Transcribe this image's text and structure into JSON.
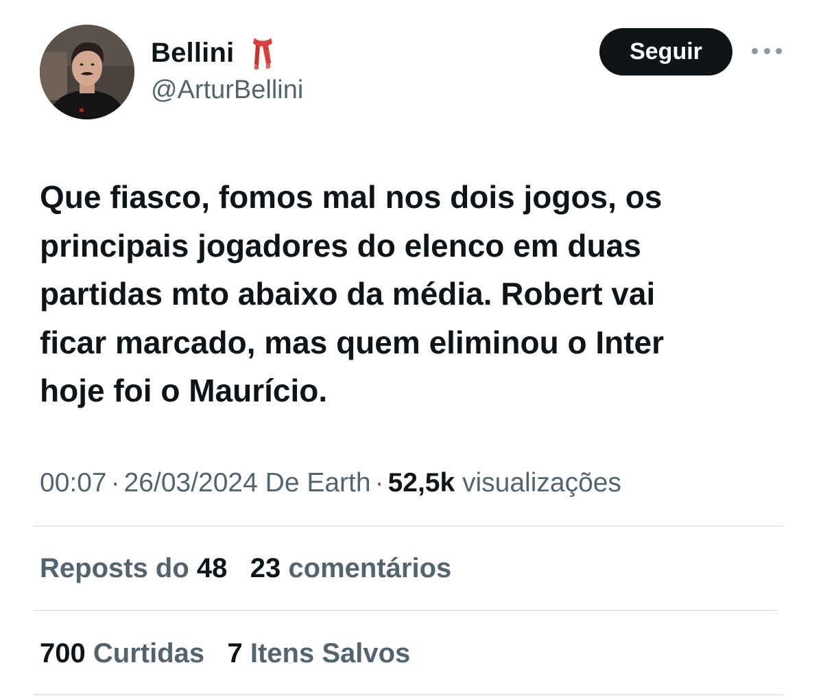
{
  "author": {
    "display_name": "Bellini",
    "handle": "@ArturBellini",
    "avatar_icon": "profile-photo",
    "badge_icon": "scarf-icon"
  },
  "follow_button": {
    "label": "Seguir"
  },
  "more_icon": "more-horizontal-icon",
  "tweet": {
    "lines": [
      "Que fiasco, fomos mal nos dois jogos, os",
      "principais jogadores do elenco em duas",
      "partidas mto abaixo da média. Robert vai",
      "ficar marcado, mas quem eliminou o Inter",
      "hoje foi o Maurício."
    ]
  },
  "meta": {
    "time": "00:07",
    "separator": "·",
    "date": "26/03/2024",
    "source": "De Earth",
    "views_count": "52,5k",
    "views_label": "visualizações"
  },
  "stats": {
    "reposts_label": "Reposts do",
    "reposts_count": "48",
    "comments_count": "23",
    "comments_label": "comentários",
    "likes_count": "700",
    "likes_label": "Curtidas",
    "saves_count": "7",
    "saves_label": "Itens Salvos"
  },
  "colors": {
    "text_primary": "#0f1419",
    "text_secondary": "#536471",
    "follow_bg": "#0f1419",
    "follow_text": "#ffffff",
    "divider": "#d6dbe0",
    "scarf": "#d9403a"
  }
}
